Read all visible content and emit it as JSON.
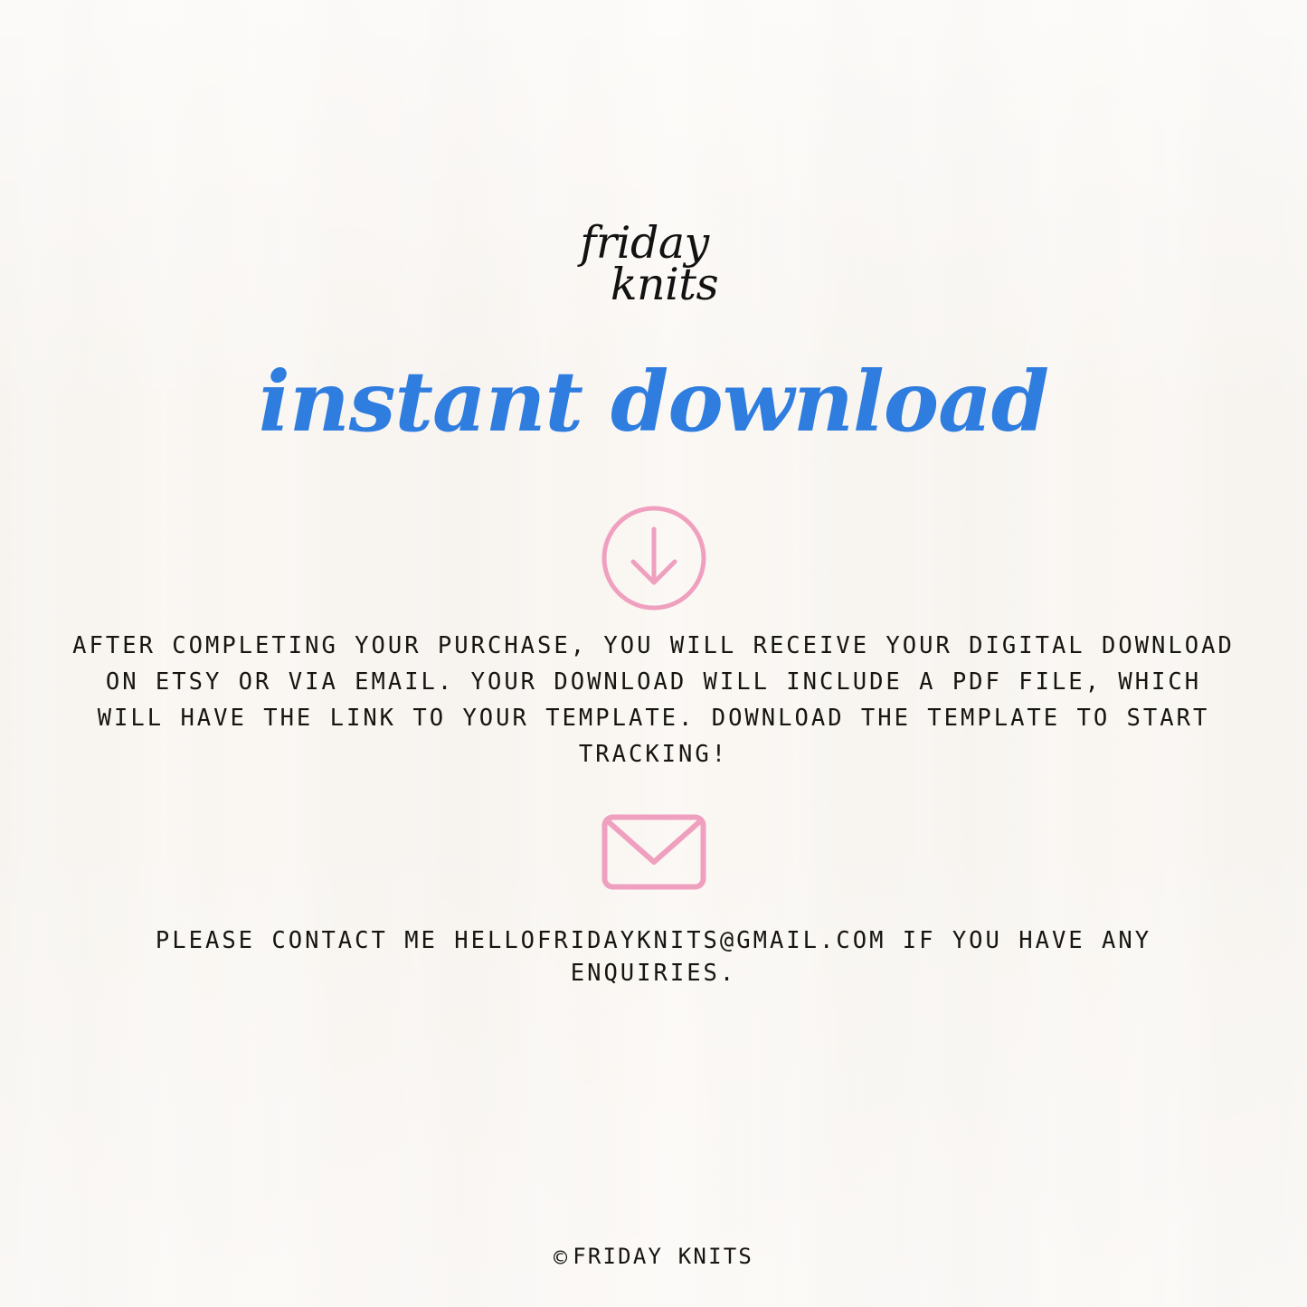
{
  "brand": {
    "logo_line1": "friday",
    "logo_line2": "knits"
  },
  "headline": "instant download",
  "icons": {
    "download": "download-circle-arrow-icon",
    "email": "envelope-icon",
    "copyright": "©"
  },
  "body": {
    "paragraph": "AFTER COMPLETING YOUR PURCHASE, YOU WILL RECEIVE YOUR DIGITAL DOWNLOAD ON ETSY OR VIA EMAIL. YOUR DOWNLOAD WILL INCLUDE A PDF FILE, WHICH WILL HAVE THE LINK TO YOUR TEMPLATE. DOWNLOAD THE TEMPLATE TO START TRACKING!"
  },
  "contact": {
    "line": "PLEASE CONTACT ME HELLOFRIDAYKNITS@GMAIL.COM IF YOU HAVE ANY ENQUIRIES.",
    "email": "HELLOFRIDAYKNITS@GMAIL.COM"
  },
  "footer": {
    "copyright_symbol": "©",
    "text": "FRIDAY KNITS"
  },
  "colors": {
    "background": "#f8f5f1",
    "accent_blue": "#2f7ddf",
    "accent_pink": "#f0a0bf",
    "text": "#17150f",
    "logo": "#121212"
  }
}
